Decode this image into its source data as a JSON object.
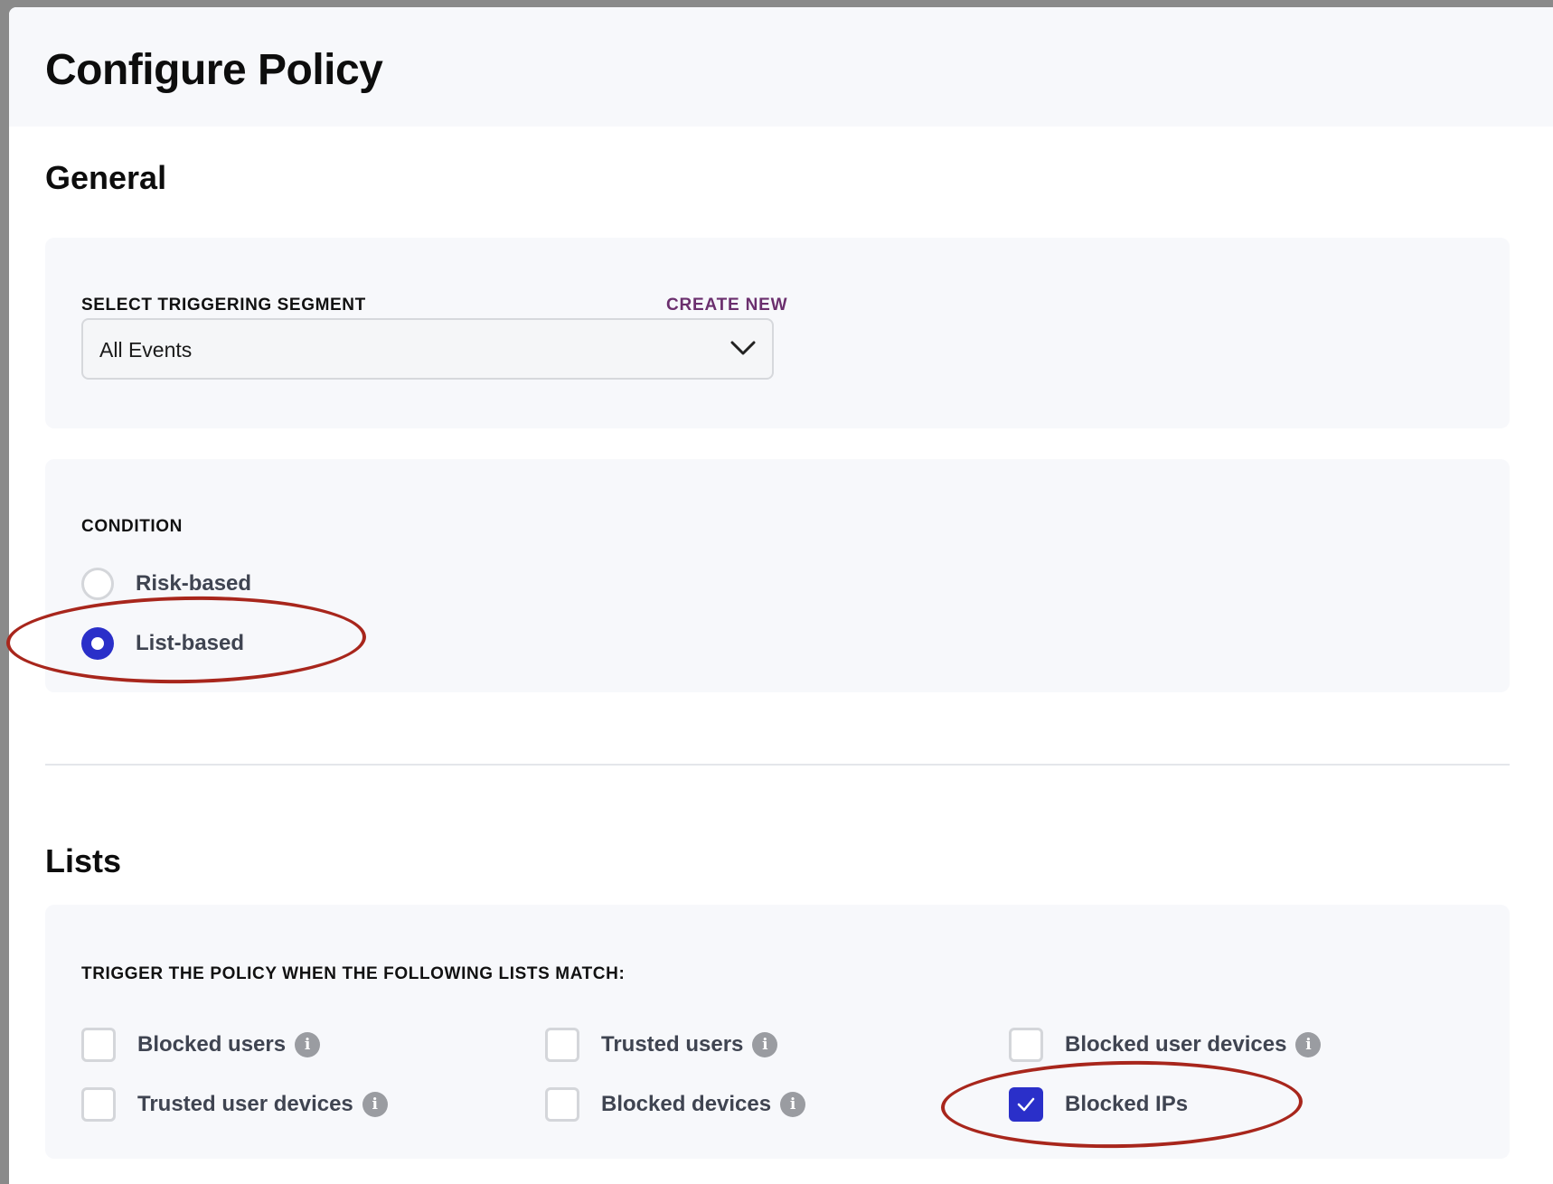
{
  "modal": {
    "title": "Configure Policy"
  },
  "general": {
    "title": "General",
    "segment": {
      "label": "SELECT TRIGGERING SEGMENT",
      "create_new": "CREATE NEW",
      "selected": "All Events",
      "icon": "chevron-down-icon"
    },
    "condition": {
      "label": "CONDITION",
      "options": [
        {
          "label": "Risk-based",
          "checked": false
        },
        {
          "label": "List-based",
          "checked": true
        }
      ]
    }
  },
  "lists": {
    "title": "Lists",
    "trigger_label": "TRIGGER THE POLICY WHEN THE FOLLOWING LISTS MATCH:",
    "items": [
      {
        "label": "Blocked users",
        "checked": false,
        "info": true
      },
      {
        "label": "Trusted users",
        "checked": false,
        "info": true
      },
      {
        "label": "Blocked user devices",
        "checked": false,
        "info": true
      },
      {
        "label": "Trusted user devices",
        "checked": false,
        "info": true
      },
      {
        "label": "Blocked devices",
        "checked": false,
        "info": true
      },
      {
        "label": "Blocked IPs",
        "checked": true,
        "info": false
      }
    ]
  },
  "colors": {
    "accent": "#2a2fc9",
    "create_new": "#6b2f6e",
    "annotation": "#a8261c",
    "card_bg": "#f7f8fb"
  }
}
